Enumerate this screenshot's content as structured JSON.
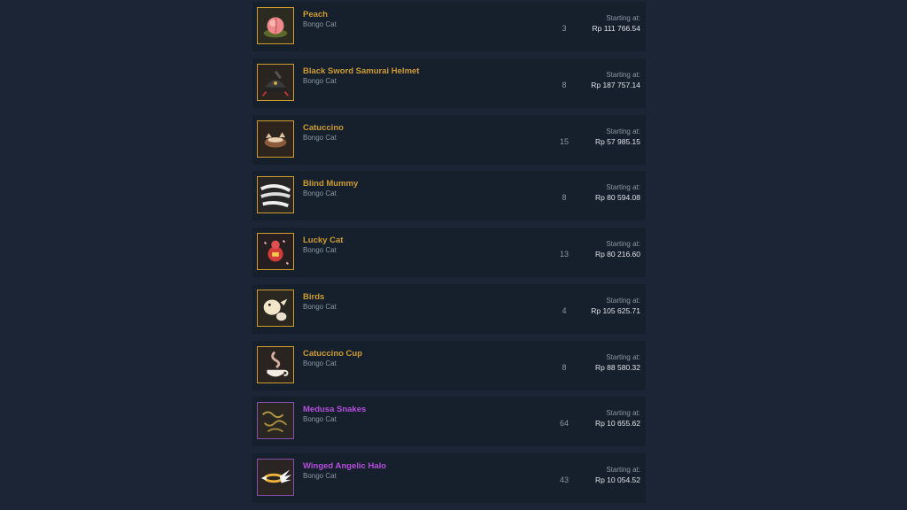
{
  "listings": [
    {
      "name": "Peach",
      "game": "Bongo Cat",
      "quantity": "3",
      "price_label": "Starting at:",
      "price": "Rp 111 766.54",
      "rarity_color": "#cf9c2e",
      "icon": "peach-icon"
    },
    {
      "name": "Black Sword Samurai Helmet",
      "game": "Bongo Cat",
      "quantity": "8",
      "price_label": "Starting at:",
      "price": "Rp 187 757.14",
      "rarity_color": "#cf9c2e",
      "icon": "samurai-helmet-icon"
    },
    {
      "name": "Catuccino",
      "game": "Bongo Cat",
      "quantity": "15",
      "price_label": "Starting at:",
      "price": "Rp 57 985.15",
      "rarity_color": "#cf9c2e",
      "icon": "catuccino-icon"
    },
    {
      "name": "Blind Mummy",
      "game": "Bongo Cat",
      "quantity": "8",
      "price_label": "Starting at:",
      "price": "Rp 80 594.08",
      "rarity_color": "#cf9c2e",
      "icon": "mummy-bandage-icon"
    },
    {
      "name": "Lucky Cat",
      "game": "Bongo Cat",
      "quantity": "13",
      "price_label": "Starting at:",
      "price": "Rp 80 216.60",
      "rarity_color": "#cf9c2e",
      "icon": "lucky-cat-icon"
    },
    {
      "name": "Birds",
      "game": "Bongo Cat",
      "quantity": "4",
      "price_label": "Starting at:",
      "price": "Rp 105 625.71",
      "rarity_color": "#cf9c2e",
      "icon": "birds-icon"
    },
    {
      "name": "Catuccino Cup",
      "game": "Bongo Cat",
      "quantity": "8",
      "price_label": "Starting at:",
      "price": "Rp 88 580.32",
      "rarity_color": "#cf9c2e",
      "icon": "coffee-cup-icon"
    },
    {
      "name": "Medusa Snakes",
      "game": "Bongo Cat",
      "quantity": "64",
      "price_label": "Starting at:",
      "price": "Rp 10 655.62",
      "rarity_color": "#b64fdc",
      "icon": "snakes-icon"
    },
    {
      "name": "Winged Angelic Halo",
      "game": "Bongo Cat",
      "quantity": "43",
      "price_label": "Starting at:",
      "price": "Rp 10 054.52",
      "rarity_color": "#b64fdc",
      "icon": "winged-halo-icon"
    }
  ]
}
